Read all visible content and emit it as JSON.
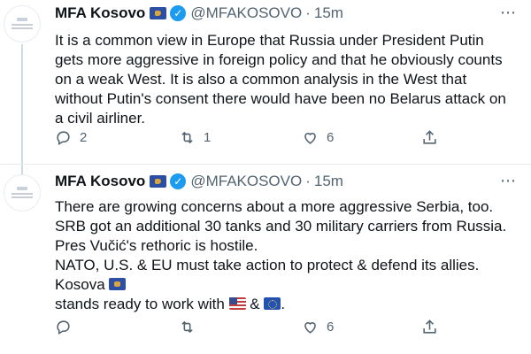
{
  "tweets": [
    {
      "name": "MFA Kosovo",
      "handle": "@MFAKOSOVO",
      "separator": "·",
      "time": "15m",
      "text_lines": [
        "It is a common view in Europe that Russia under President Putin gets more aggressive in foreign policy and that he obviously counts on a weak West. It is also a common analysis in the West that without Putin's consent there would have been no Belarus attack on a civil airliner."
      ],
      "reply_count": "2",
      "retweet_count": "1",
      "like_count": "6"
    },
    {
      "name": "MFA Kosovo",
      "handle": "@MFAKOSOVO",
      "separator": "·",
      "time": "15m",
      "text_part1": "There are growing concerns about a more aggressive Serbia, too. SRB got an additional 30 tanks and 30 military carriers from Russia. Pres Vučić's rethoric is hostile.",
      "text_part2": "NATO, U.S. & EU must take action to protect & defend its allies. Kosova",
      "text_part3": "stands ready to work with",
      "text_amp": "&",
      "text_end": ".",
      "reply_count": "",
      "retweet_count": "",
      "like_count": "6"
    }
  ],
  "more_icon": "⋯",
  "verified_icon": "✓",
  "icons": [
    "reply-icon",
    "retweet-icon",
    "like-icon",
    "share-icon",
    "verified-icon",
    "kosovo-flag-icon",
    "us-flag-icon",
    "eu-flag-icon"
  ],
  "colors": {
    "accent": "#1d9bf0",
    "text": "#0f1419",
    "secondary": "#536471",
    "divider": "#e6ecf0"
  }
}
